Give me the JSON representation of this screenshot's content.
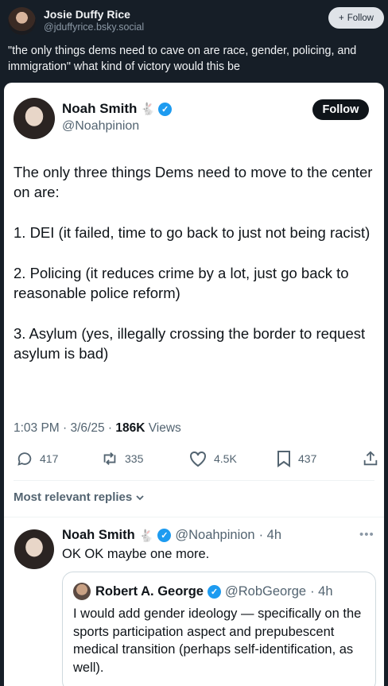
{
  "outer_post": {
    "author_name": "Josie Duffy Rice",
    "author_handle": "@jduffyrice.bsky.social",
    "follow_label": "Follow",
    "text": "\"the only things dems need to cave on are race, gender, policing, and immigration\" what kind of victory would this be"
  },
  "tweet": {
    "author_name": "Noah Smith",
    "author_handle": "@Noahpinion",
    "follow_label": "Follow",
    "paragraphs": [
      "The only three things Dems need to move to the center on are:",
      "1. DEI (it failed, time to go back to just not being racist)",
      "2. Policing (it reduces crime by a lot, just go back to reasonable police reform)",
      "3. Asylum (yes, illegally crossing the border to request asylum is bad)"
    ],
    "timestamp": "1:03 PM · 3/6/25 · ",
    "views_count": "186K",
    "views_label": " Views",
    "replies": "417",
    "reposts": "335",
    "likes": "4.5K",
    "bookmarks": "437"
  },
  "replies_section": {
    "label": "Most relevant replies"
  },
  "reply": {
    "author_name": "Noah Smith",
    "author_handle": "@Noahpinion",
    "time": "· 4h",
    "text": "OK OK maybe one more.",
    "quote": {
      "author_name": "Robert A. George",
      "author_handle": "@RobGeorge",
      "time": "· 4h",
      "text": "I would add gender ideology — specifically on the sports participation aspect and prepubescent medical transition (perhaps self-identification, as well)."
    }
  },
  "colors": {
    "page_bg": "#161e27",
    "card_bg": "#ffffff",
    "verified_blue": "#1d9bf0",
    "muted_text": "#536471"
  },
  "icons": [
    "plus-icon",
    "verified-badge-icon",
    "rabbit-emoji-icon",
    "reply-icon",
    "repost-icon",
    "like-icon",
    "bookmark-icon",
    "share-icon",
    "chevron-down-icon",
    "more-icon"
  ]
}
